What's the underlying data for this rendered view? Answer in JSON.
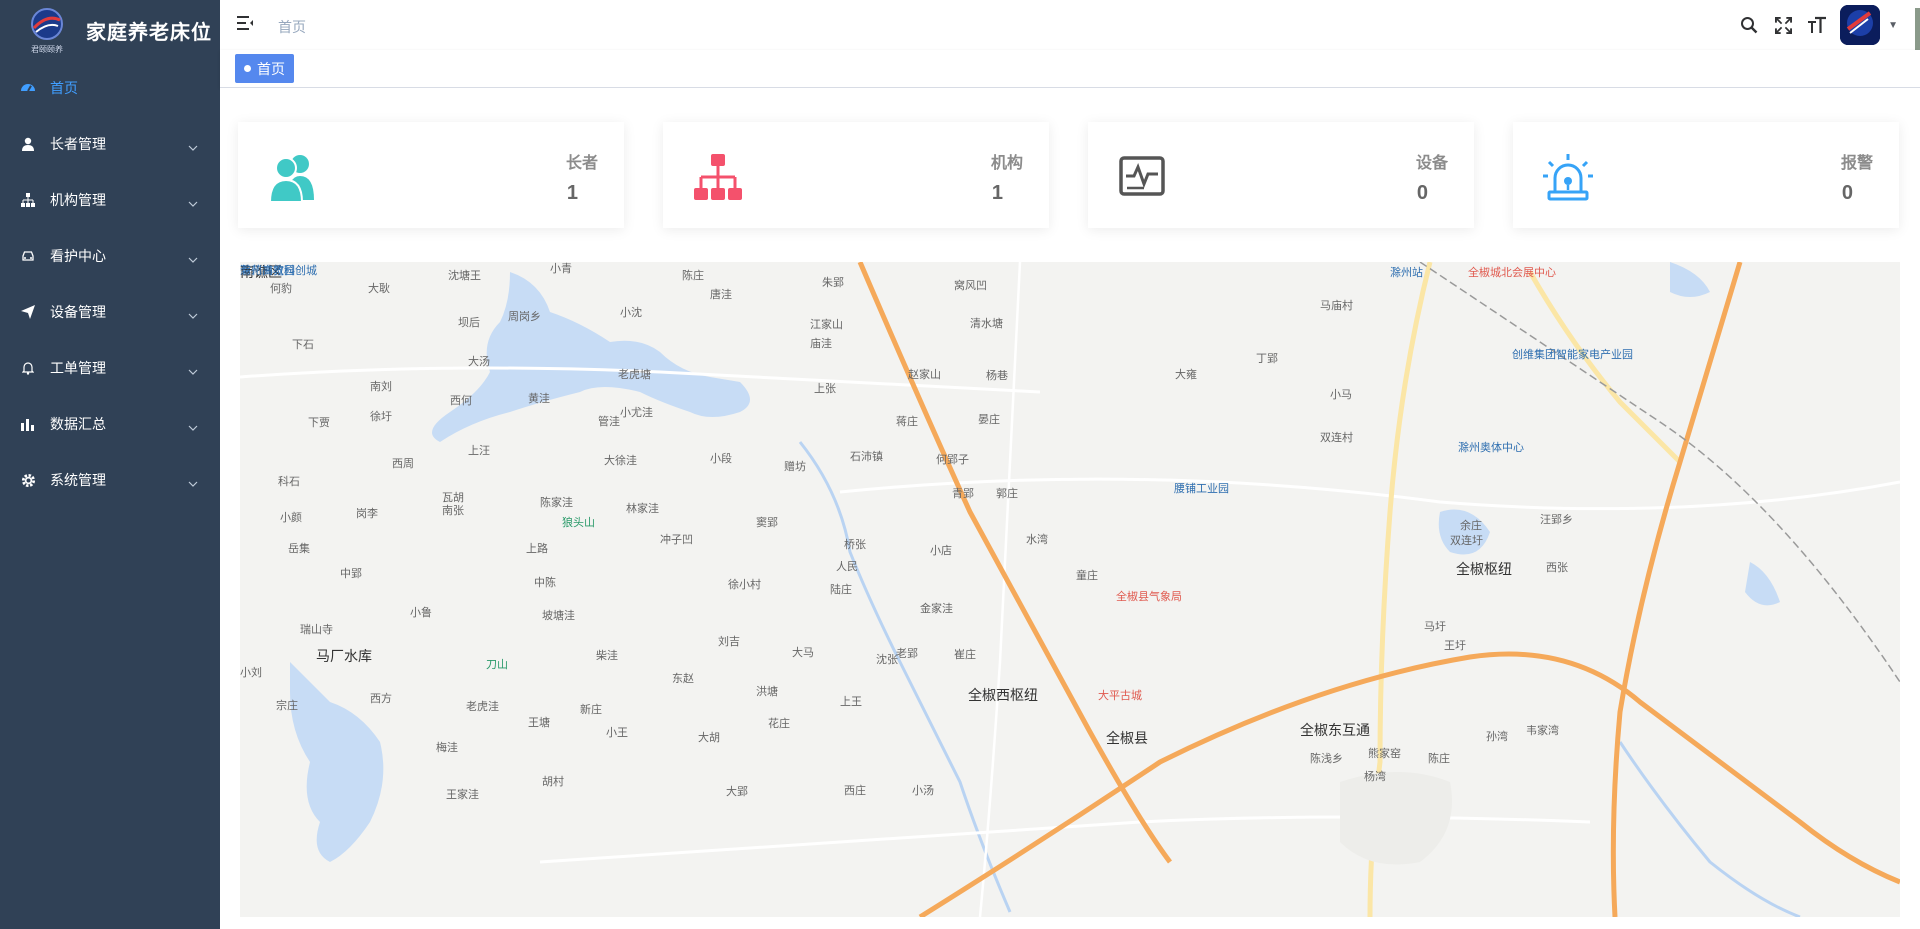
{
  "app": {
    "title": "家庭养老床位",
    "logo_caption": "君颐颐养"
  },
  "sidebar": {
    "items": [
      {
        "label": "首页",
        "icon": "dashboard-icon",
        "active": true
      },
      {
        "label": "长者管理",
        "icon": "user-icon"
      },
      {
        "label": "机构管理",
        "icon": "org-tree-icon"
      },
      {
        "label": "看护中心",
        "icon": "car-icon"
      },
      {
        "label": "设备管理",
        "icon": "paper-plane-icon"
      },
      {
        "label": "工单管理",
        "icon": "bell-icon"
      },
      {
        "label": "数据汇总",
        "icon": "bar-chart-icon"
      },
      {
        "label": "系统管理",
        "icon": "gear-icon"
      }
    ]
  },
  "header": {
    "breadcrumb": "首页",
    "tools": [
      "search-icon",
      "fullscreen-icon",
      "font-size-icon"
    ]
  },
  "tags": {
    "active": "首页"
  },
  "stats": [
    {
      "label": "长者",
      "value": "1",
      "color": "#40c9c6",
      "icon": "people-icon"
    },
    {
      "label": "机构",
      "value": "1",
      "color": "#f4516c",
      "icon": "org-tree-icon"
    },
    {
      "label": "设备",
      "value": "0",
      "color": "#555555",
      "icon": "monitor-icon"
    },
    {
      "label": "报警",
      "value": "0",
      "color": "#36a3f7",
      "icon": "alarm-icon"
    }
  ],
  "map": {
    "places": [
      "何豹",
      "大耿",
      "沈塘王",
      "小青",
      "陈庄",
      "唐洼",
      "朱郢",
      "窝风凹",
      "周岗乡",
      "小沈",
      "江家山",
      "清水塘",
      "下石",
      "坝后",
      "大汤",
      "庙洼",
      "南刘",
      "西何",
      "黄洼",
      "老虎塘",
      "赵家山",
      "杨巷",
      "上张",
      "下贾",
      "徐圩",
      "管洼",
      "小尤洼",
      "蒋庄",
      "晏庄",
      "上汪",
      "西周",
      "大徐洼",
      "小段",
      "石沛镇",
      "何郢子",
      "科石",
      "瓦胡",
      "南张",
      "陈家洼",
      "林家洼",
      "赠坊",
      "青郢",
      "郭庄",
      "小颜",
      "岗李",
      "狼头山",
      "窦郢",
      "岳集",
      "上路",
      "冲子凹",
      "桥张",
      "小店",
      "水湾",
      "中郢",
      "人民",
      "中陈",
      "徐小村",
      "陆庄",
      "金家洼",
      "童庄",
      "小鲁",
      "坡塘洼",
      "瑞山寺",
      "马厂水库",
      "刀山",
      "柴洼",
      "刘吉",
      "大马",
      "老郢",
      "沈张",
      "崔庄",
      "小刘",
      "东赵",
      "洪塘",
      "宗庄",
      "西方",
      "老虎洼",
      "新庄",
      "上王",
      "花庄",
      "王塘",
      "小王",
      "大胡",
      "梅洼",
      "胡村",
      "王家洼",
      "大郢",
      "西庄",
      "小汤",
      "全椒西枢纽",
      "大平古城",
      "全椒县",
      "全椒县气象局",
      "全椒东互通",
      "陈庄",
      "陈浅乡",
      "杨湾",
      "熊家窑",
      "孙湾",
      "韦家湾",
      "王圩",
      "马圩",
      "西张",
      "全椒枢纽",
      "余庄",
      "汪郢乡",
      "双连圩",
      "双连村",
      "小马",
      "马庙村",
      "丁郢",
      "大雍",
      "腰铺工业园",
      "滁州站",
      "全椒城北会展中心",
      "创维集团智能家电产业园",
      "滁州奥体中心",
      "菊花博览园",
      "南谯区",
      "滁州高教科创城"
    ]
  }
}
